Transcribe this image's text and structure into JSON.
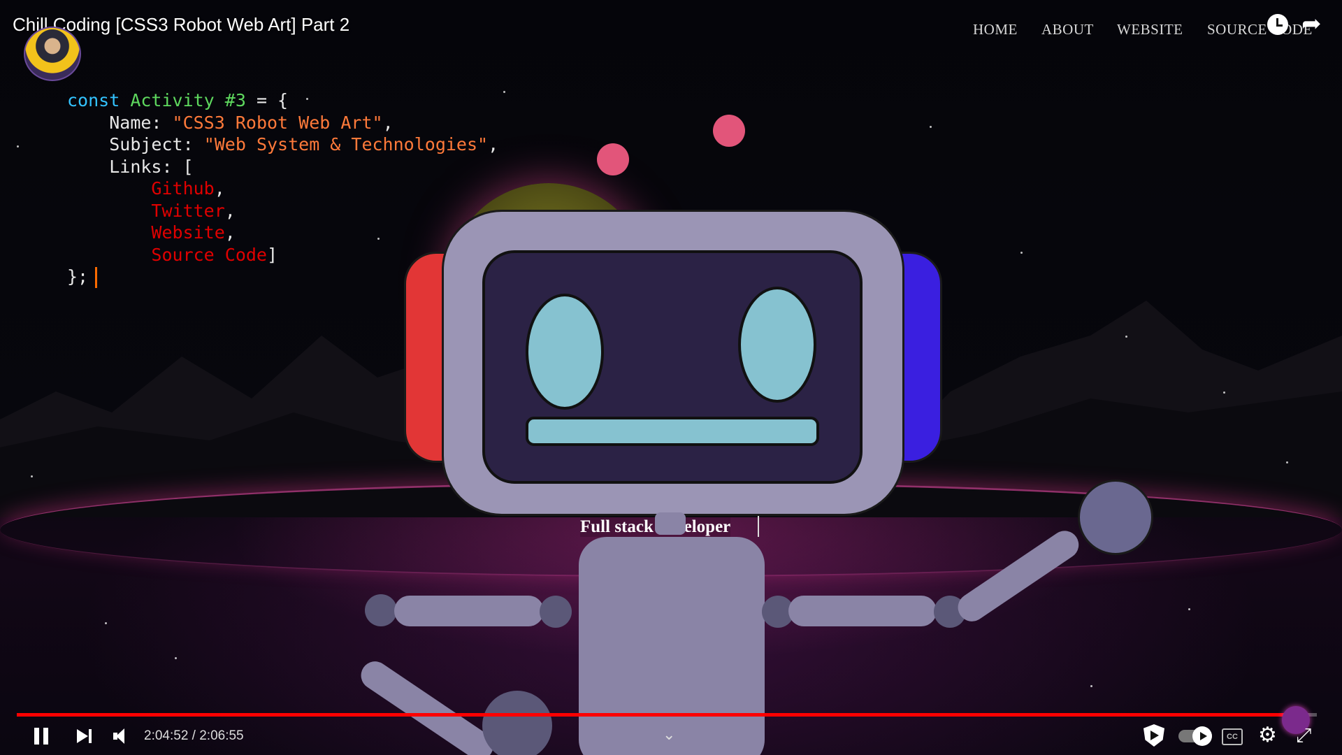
{
  "video": {
    "title": "Chill Coding [CSS3 Robot Web Art] Part 2"
  },
  "site_nav": {
    "items": [
      "HOME",
      "ABOUT",
      "WEBSITE",
      "SOURCE CODE"
    ]
  },
  "code": {
    "keyword": "const",
    "var_name": "Activity #3",
    "open": " = {",
    "name_key": "Name: ",
    "name_value": "\"CSS3 Robot Web Art\"",
    "subject_key": "Subject: ",
    "subject_value": "\"Web System & Technologies\"",
    "links_key": "Links: [",
    "links": [
      "Github",
      "Twitter",
      "Website",
      "Source Code"
    ],
    "close": "};"
  },
  "robot": {
    "tagline": "Full stack developer"
  },
  "player": {
    "current_time": "2:04:52",
    "duration": "2:06:55",
    "time_display": "2:04:52 / 2:06:55",
    "progress_fraction": 0.984,
    "cc_label": "CC"
  },
  "colors": {
    "progress": "#ff0000",
    "keyword": "#33c3ff",
    "variable": "#5ed85e",
    "string": "#ff7a3a",
    "link": "#e00000"
  }
}
